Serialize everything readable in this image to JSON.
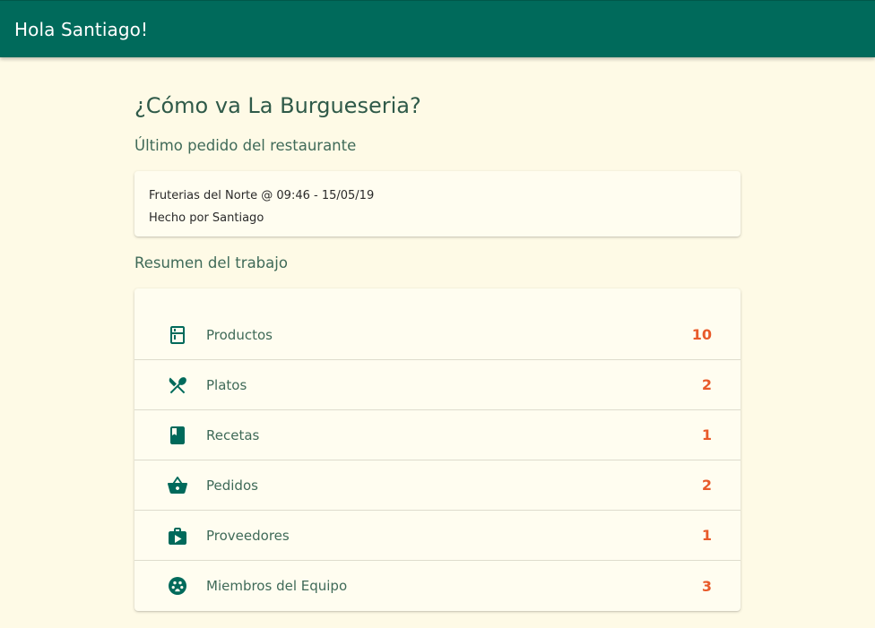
{
  "header": {
    "greeting": "Hola Santiago!"
  },
  "page": {
    "title": "¿Cómo va La Burgueseria?"
  },
  "last_order": {
    "section_title": "Último pedido del restaurante",
    "line1": "Fruterias del Norte @ 09:46 - 15/05/19",
    "line2": "Hecho por Santiago"
  },
  "summary": {
    "section_title": "Resumen del trabajo",
    "items": [
      {
        "icon": "fridge-icon",
        "label": "Productos",
        "count": "10"
      },
      {
        "icon": "utensils-icon",
        "label": "Platos",
        "count": "2"
      },
      {
        "icon": "book-icon",
        "label": "Recetas",
        "count": "1"
      },
      {
        "icon": "basket-icon",
        "label": "Pedidos",
        "count": "2"
      },
      {
        "icon": "briefcase-icon",
        "label": "Proveedores",
        "count": "1"
      },
      {
        "icon": "team-icon",
        "label": "Miembros del Equipo",
        "count": "3"
      }
    ]
  },
  "colors": {
    "primary": "#006a5b",
    "background": "#fefae6",
    "count": "#e85a2a",
    "text": "#3f6a58"
  }
}
